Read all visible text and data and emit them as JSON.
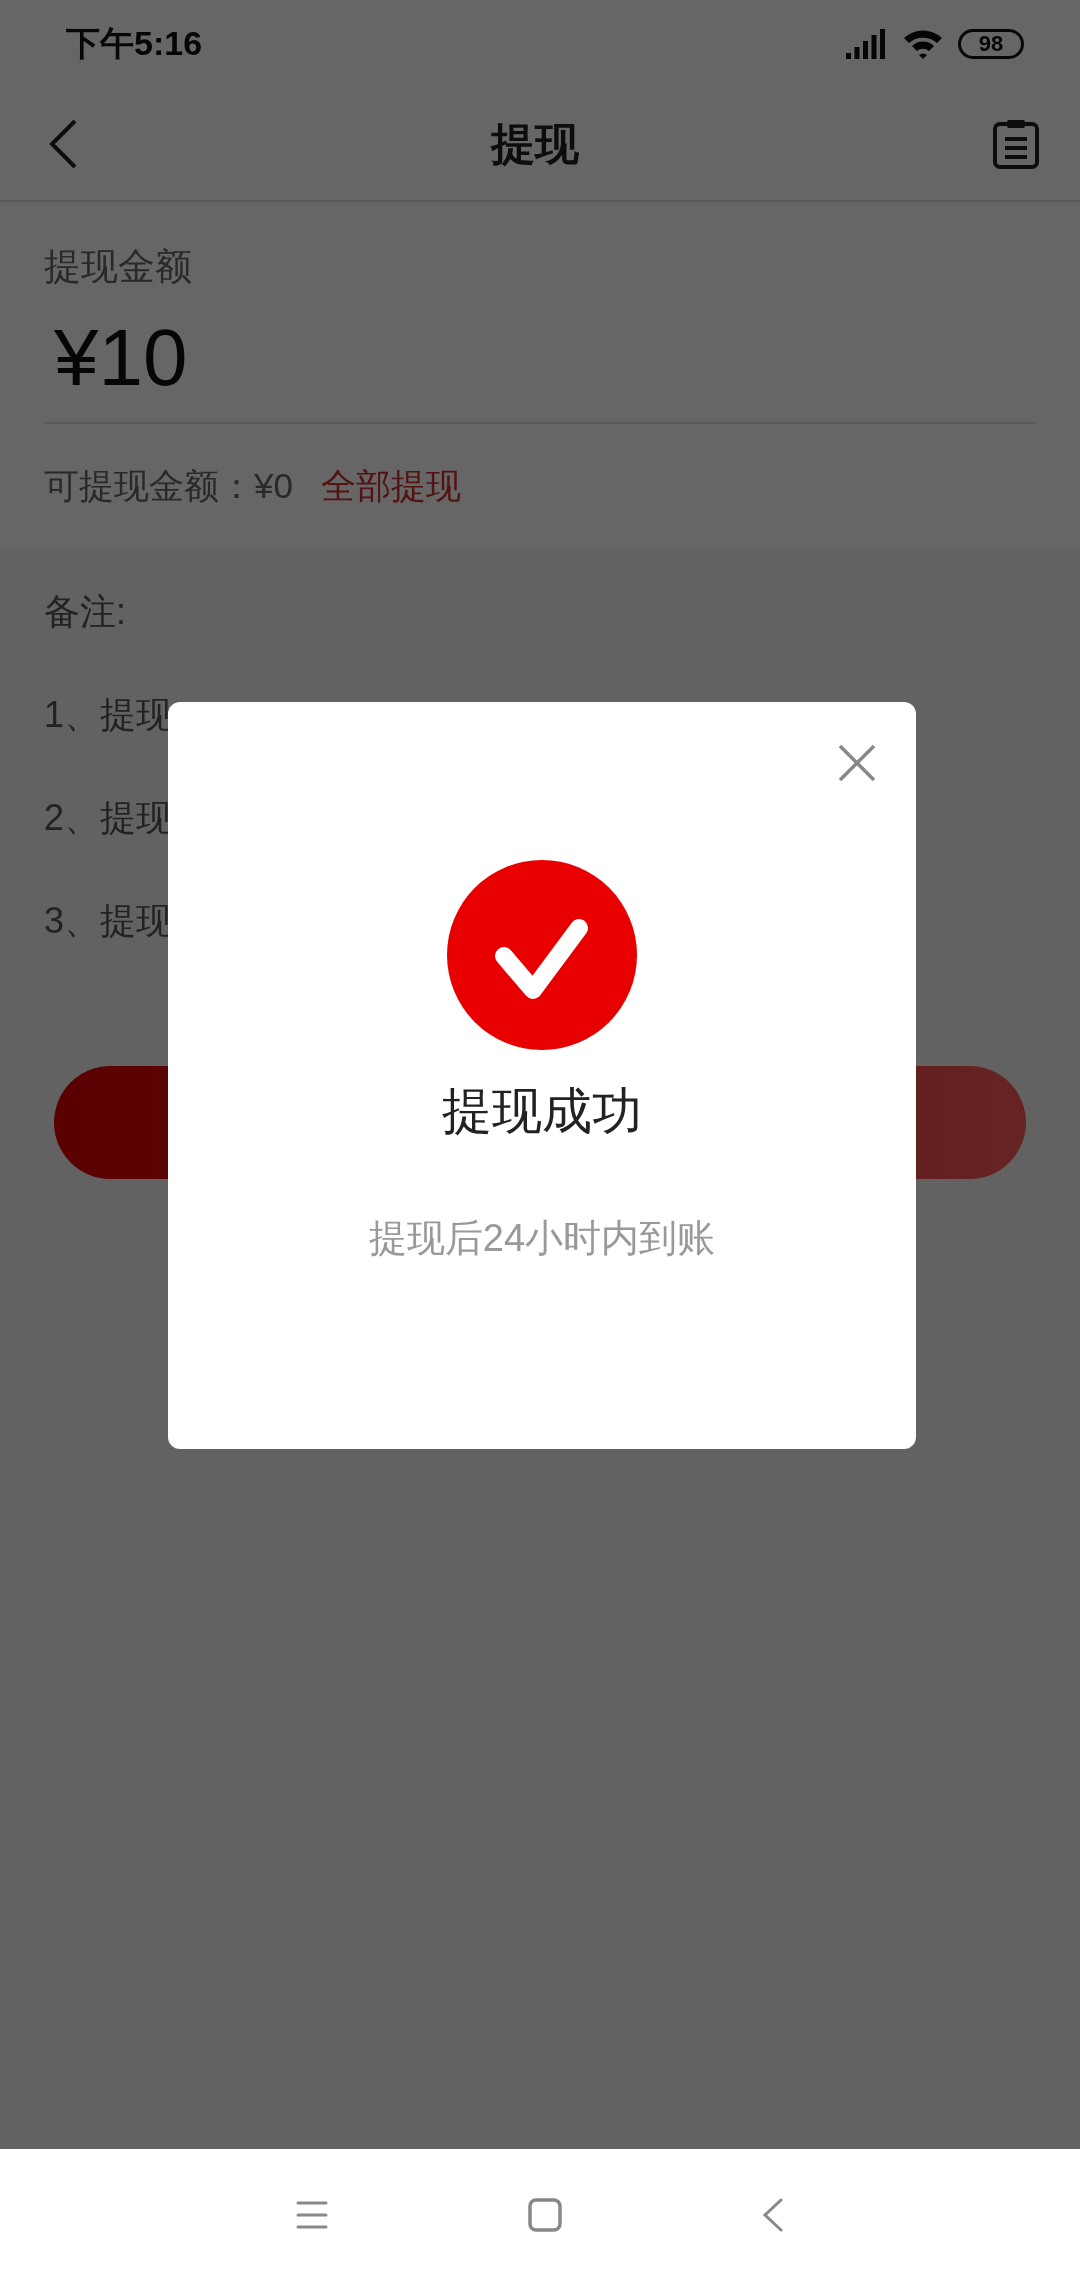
{
  "status_bar": {
    "time": "下午5:16",
    "battery": "98"
  },
  "header": {
    "title": "提现"
  },
  "amount": {
    "label": "提现金额",
    "value": "¥10"
  },
  "available": {
    "label": "可提现金额：¥0",
    "action": "全部提现"
  },
  "notes": {
    "title": "备注:",
    "items": [
      "1、提现",
      "2、提现",
      "3、提现"
    ]
  },
  "dialog": {
    "title": "提现成功",
    "message": "提现后24小时内到账"
  }
}
